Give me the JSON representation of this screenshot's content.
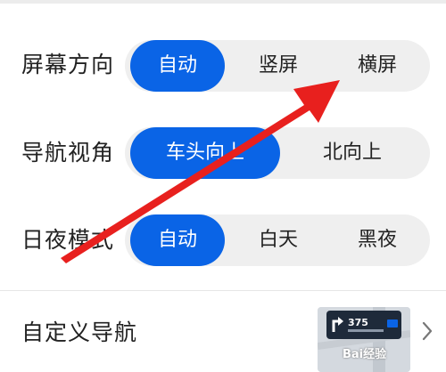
{
  "screen_orientation": {
    "label": "屏幕方向",
    "options": [
      "自动",
      "竖屏",
      "横屏"
    ],
    "selected": "自动"
  },
  "nav_view": {
    "label": "导航视角",
    "options": [
      "车头向上",
      "北向上"
    ],
    "selected": "车头向上"
  },
  "day_night": {
    "label": "日夜模式",
    "options": [
      "自动",
      "白天",
      "黑夜"
    ],
    "selected": "自动"
  },
  "custom_nav": {
    "label": "自定义导航",
    "thumb_distance": "375",
    "watermark": "Bai经验"
  },
  "colors": {
    "accent": "#0a64e6",
    "segment_bg": "#efefef",
    "annotation_arrow": "#e8201e"
  }
}
